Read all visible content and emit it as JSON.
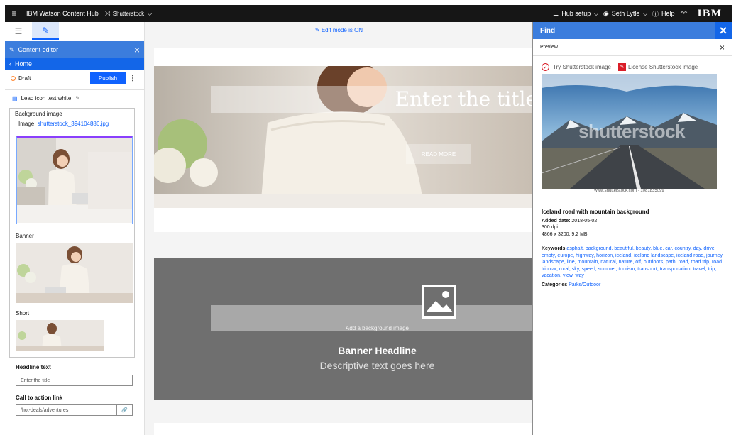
{
  "topbar": {
    "app_title": "IBM Watson Content Hub",
    "space_name": "Shutterstock",
    "hub_setup": "Hub setup",
    "user_name": "Seth Lytle",
    "help": "Help",
    "logo": "IBM"
  },
  "left": {
    "panel_title": "Content editor",
    "home": "Home",
    "status": "Draft",
    "publish": "Publish",
    "item_name": "Lead icon test white",
    "bg_label": "Background image",
    "image_prefix": "Image:",
    "image_file": "shutterstock_394104886.jpg",
    "rendition_banner": "Banner",
    "rendition_short": "Short",
    "headline_label": "Headline text",
    "headline_placeholder": "Enter the title",
    "cta_label": "Call to action link",
    "cta_value": "/hot-deals/adventures"
  },
  "main": {
    "edit_mode": "Edit mode is ON",
    "hero_title": "Enter the title",
    "read_more": "READ MORE",
    "add_bg": "Add a background image",
    "banner_headline": "Banner Headline",
    "banner_desc": "Descriptive text goes here"
  },
  "find": {
    "title": "Find",
    "preview": "Preview",
    "try_label": "Try Shutterstock image",
    "license_label": "License Shutterstock image",
    "watermark": "shutterstock",
    "credit": "www.shutterstock.com · 1081835099",
    "image_title": "Iceland road with mountain background",
    "added_label": "Added date:",
    "added_date": "2018-05-02",
    "dpi": "300 dpi",
    "size": "4866 x 3200, 9.2 MB",
    "keywords_label": "Keywords",
    "keywords": "asphalt, background, beautiful, beauty, blue, car, country, day, drive, empty, europe, highway, horizon, iceland, iceland landscape, iceland road, journey, landscape, line, mountain, natural, nature, off, outdoors, path, road, road trip, road trip car, rural, sky, speed, summer, tourism, transport, transportation, travel, trip, vacation, view, way",
    "categories_label": "Categories",
    "categories": "Parks/Outdoor"
  },
  "colors": {
    "accent": "#0f62fe",
    "header": "#3b7ddd",
    "dark": "#161616"
  }
}
